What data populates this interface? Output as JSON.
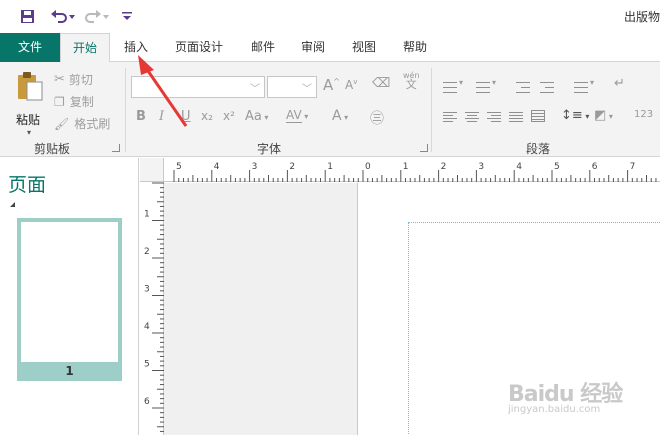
{
  "app": {
    "title": "出版物"
  },
  "quick_access": [
    {
      "name": "save-icon",
      "glyph": "💾"
    },
    {
      "name": "undo-icon",
      "glyph": "↶"
    },
    {
      "name": "redo-icon",
      "glyph": "↷"
    },
    {
      "name": "customize-icon",
      "glyph": "▾"
    }
  ],
  "tabs": [
    "文件",
    "开始",
    "插入",
    "页面设计",
    "邮件",
    "审阅",
    "视图",
    "帮助"
  ],
  "ribbon": {
    "clipboard": {
      "paste": "粘贴",
      "cut": "剪切",
      "copy": "复制",
      "format_painter": "格式刷",
      "group_label": "剪贴板"
    },
    "font": {
      "group_label": "字体",
      "bold": "B",
      "italic": "I",
      "underline": "U",
      "subscript": "x₂",
      "superscript": "x²",
      "change_case": "Aa",
      "char_spacing": "AV",
      "grow_font": "A",
      "shrink_font": "A",
      "font_color": "A",
      "phonetic_top": "wén",
      "phonetic_bottom": "文"
    },
    "paragraph": {
      "group_label": "段落",
      "number_format": "123"
    }
  },
  "pages_pane": {
    "title": "页面",
    "page_number": "1"
  },
  "ruler": {
    "h_labels": [
      "5",
      "4",
      "3",
      "2",
      "1",
      "0",
      "1",
      "2",
      "3",
      "4",
      "5",
      "6",
      "7"
    ],
    "v_labels": [
      "1",
      "2",
      "3",
      "4",
      "5",
      "6"
    ]
  },
  "watermark": {
    "logo": "Baidu 经验",
    "url": "jingyan.baidu.com"
  },
  "annotation": {
    "color": "#e53935",
    "points_to": "插入"
  },
  "colors": {
    "accent": "#077568",
    "thumb_frame": "#9dcfc8"
  }
}
